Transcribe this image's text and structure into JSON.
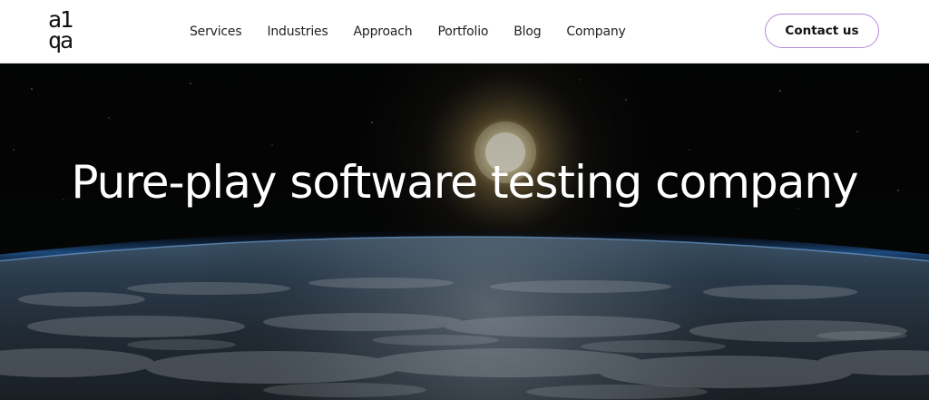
{
  "logo": {
    "line1": "a1",
    "line2": "qa"
  },
  "nav": {
    "items": [
      {
        "label": "Services"
      },
      {
        "label": "Industries"
      },
      {
        "label": "Approach"
      },
      {
        "label": "Portfolio"
      },
      {
        "label": "Blog"
      },
      {
        "label": "Company"
      }
    ]
  },
  "header": {
    "contact_label": "Contact us"
  },
  "hero": {
    "title": "Pure-play software testing company"
  },
  "colors": {
    "accent_border": "#b48bdc",
    "header_bg": "#ffffff",
    "hero_text": "#ffffff"
  }
}
